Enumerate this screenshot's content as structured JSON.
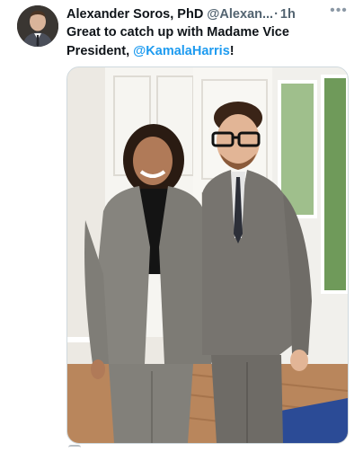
{
  "tweet": {
    "author_name": "Alexander Soros, PhD",
    "handle": "@Alexan...",
    "separator": "·",
    "timestamp": "1h",
    "more_icon": "more-horizontal-icon",
    "text_before_mention": "Great to catch up with Madame Vice President, ",
    "mention": "@KamalaHarris",
    "text_after_mention": "!"
  },
  "colors": {
    "link": "#1d9bf0",
    "secondary_text": "#536471",
    "primary_text": "#0f1419"
  }
}
